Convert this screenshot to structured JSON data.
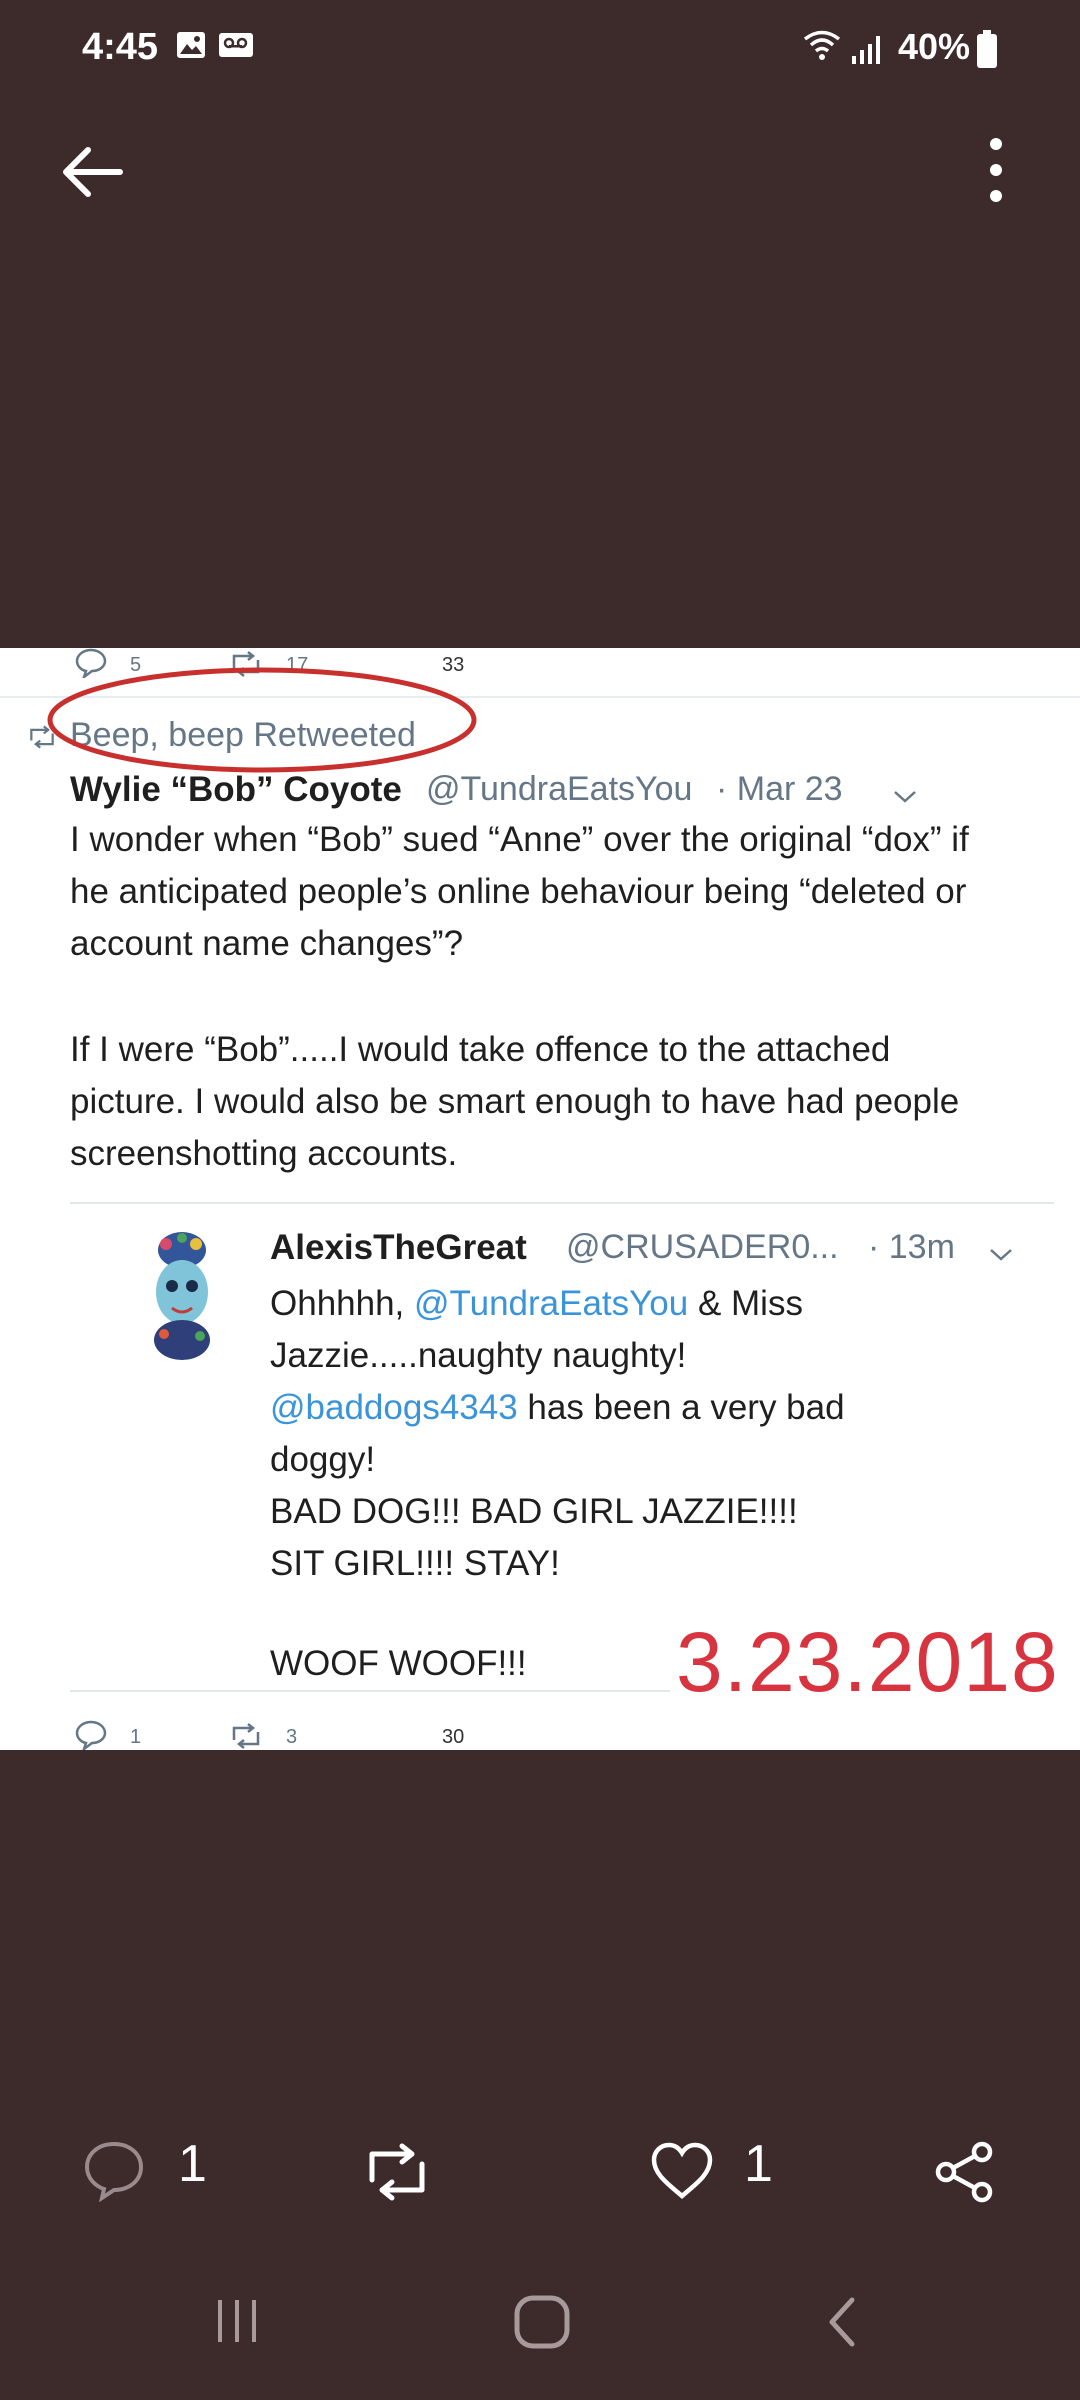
{
  "status_bar": {
    "time": "4:45",
    "battery": "40%"
  },
  "tweet": {
    "top_stats": {
      "replies": "5",
      "retweets": "17",
      "likes": "33"
    },
    "retweet_banner": "Beep, beep Retweeted",
    "author_name": "Wylie “Bob” Coyote",
    "author_handle": "@TundraEatsYou",
    "date": "· Mar 23",
    "body_lines": [
      "I wonder when “Bob” sued “Anne” over the original “dox” if",
      "he anticipated people’s online behaviour being “deleted or",
      "account name changes”?",
      "If I were “Bob”.....I would take offence to the attached",
      "picture. I would also be smart enough to have had people",
      "screenshotting accounts."
    ],
    "quoted": {
      "name": "AlexisTheGreat",
      "handle": "@CRUSADER0...",
      "time": "· 13m",
      "line1_prefix": "Ohhhhh, ",
      "mention1": "@TundraEatsYou",
      "line1_suffix": " & Miss",
      "line2": "Jazzie.....naughty naughty!",
      "mention2": "@baddogs4343",
      "line3_suffix": " has been a very bad",
      "line4": "doggy!",
      "line5": "BAD DOG!!! BAD GIRL JAZZIE!!!!",
      "line6": "SIT GIRL!!!! STAY!",
      "line7": "WOOF WOOF!!!"
    },
    "stamp_date": "3.23.2018",
    "bottom_stats": {
      "replies": "1",
      "retweets": "3",
      "likes": "30"
    }
  },
  "bottom_bar": {
    "comments": "1",
    "likes": "1"
  },
  "colors": {
    "background": "#3d2a2b",
    "stamp_red": "#d8343f",
    "mention_blue": "#3b94d9",
    "circle_red": "#c8302e"
  }
}
